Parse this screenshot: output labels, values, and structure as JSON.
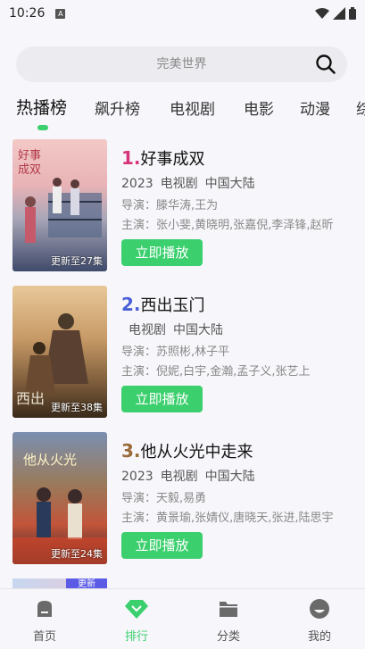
{
  "status_bar": {
    "time": "10:26",
    "sim_label": "A"
  },
  "search": {
    "placeholder": "完美世界"
  },
  "tabs": [
    {
      "label": "热播榜"
    },
    {
      "label": "飙升榜"
    },
    {
      "label": "电视剧"
    },
    {
      "label": "电影"
    },
    {
      "label": "动漫"
    },
    {
      "label": "综"
    }
  ],
  "items": [
    {
      "rank": "1.",
      "rank_color": "#d6337a",
      "title": "好事成双",
      "year": "2023",
      "type": "电视剧",
      "region": "中国大陆",
      "director": "导演：滕华涛,王为",
      "cast": "主演：张小斐,黄晓明,张嘉倪,李泽锋,赵昕",
      "update": "更新至27集",
      "play_label": "立即播放"
    },
    {
      "rank": "2.",
      "rank_color": "#4a5fd6",
      "title": "西出玉门",
      "year": "",
      "type": "电视剧",
      "region": "中国大陆",
      "director": "导演：苏照彬,林子平",
      "cast": "主演：倪妮,白宇,金瀚,孟子义,张艺上",
      "update": "更新至38集",
      "play_label": "立即播放"
    },
    {
      "rank": "3.",
      "rank_color": "#9a6a3a",
      "title": "他从火光中走来",
      "year": "2023",
      "type": "电视剧",
      "region": "中国大陆",
      "director": "导演：天毅,易勇",
      "cast": "主演：黄景瑜,张婧仪,唐晓天,张进,陆思宇",
      "update": "更新至24集",
      "play_label": "立即播放"
    }
  ],
  "peek_badge": "更新",
  "nav": [
    {
      "label": "首页",
      "icon": "home-icon"
    },
    {
      "label": "排行",
      "icon": "rank-diamond-icon"
    },
    {
      "label": "分类",
      "icon": "folder-icon"
    },
    {
      "label": "我的",
      "icon": "profile-icon"
    }
  ],
  "colors": {
    "accent": "#3ccf6e"
  }
}
